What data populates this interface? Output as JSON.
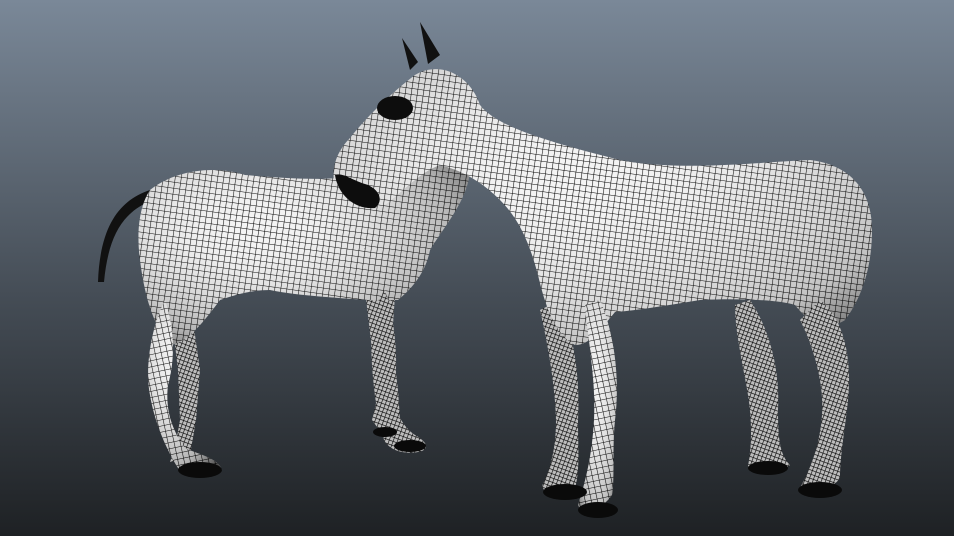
{
  "viewport": {
    "background_top": "#7a8898",
    "background_bottom": "#1e2124",
    "mesh_fill": "#ffffff",
    "mesh_line": "#000000"
  },
  "models": [
    {
      "name": "horse-back",
      "kind": "wireframe-horse"
    },
    {
      "name": "horse-front",
      "kind": "wireframe-horse"
    }
  ]
}
